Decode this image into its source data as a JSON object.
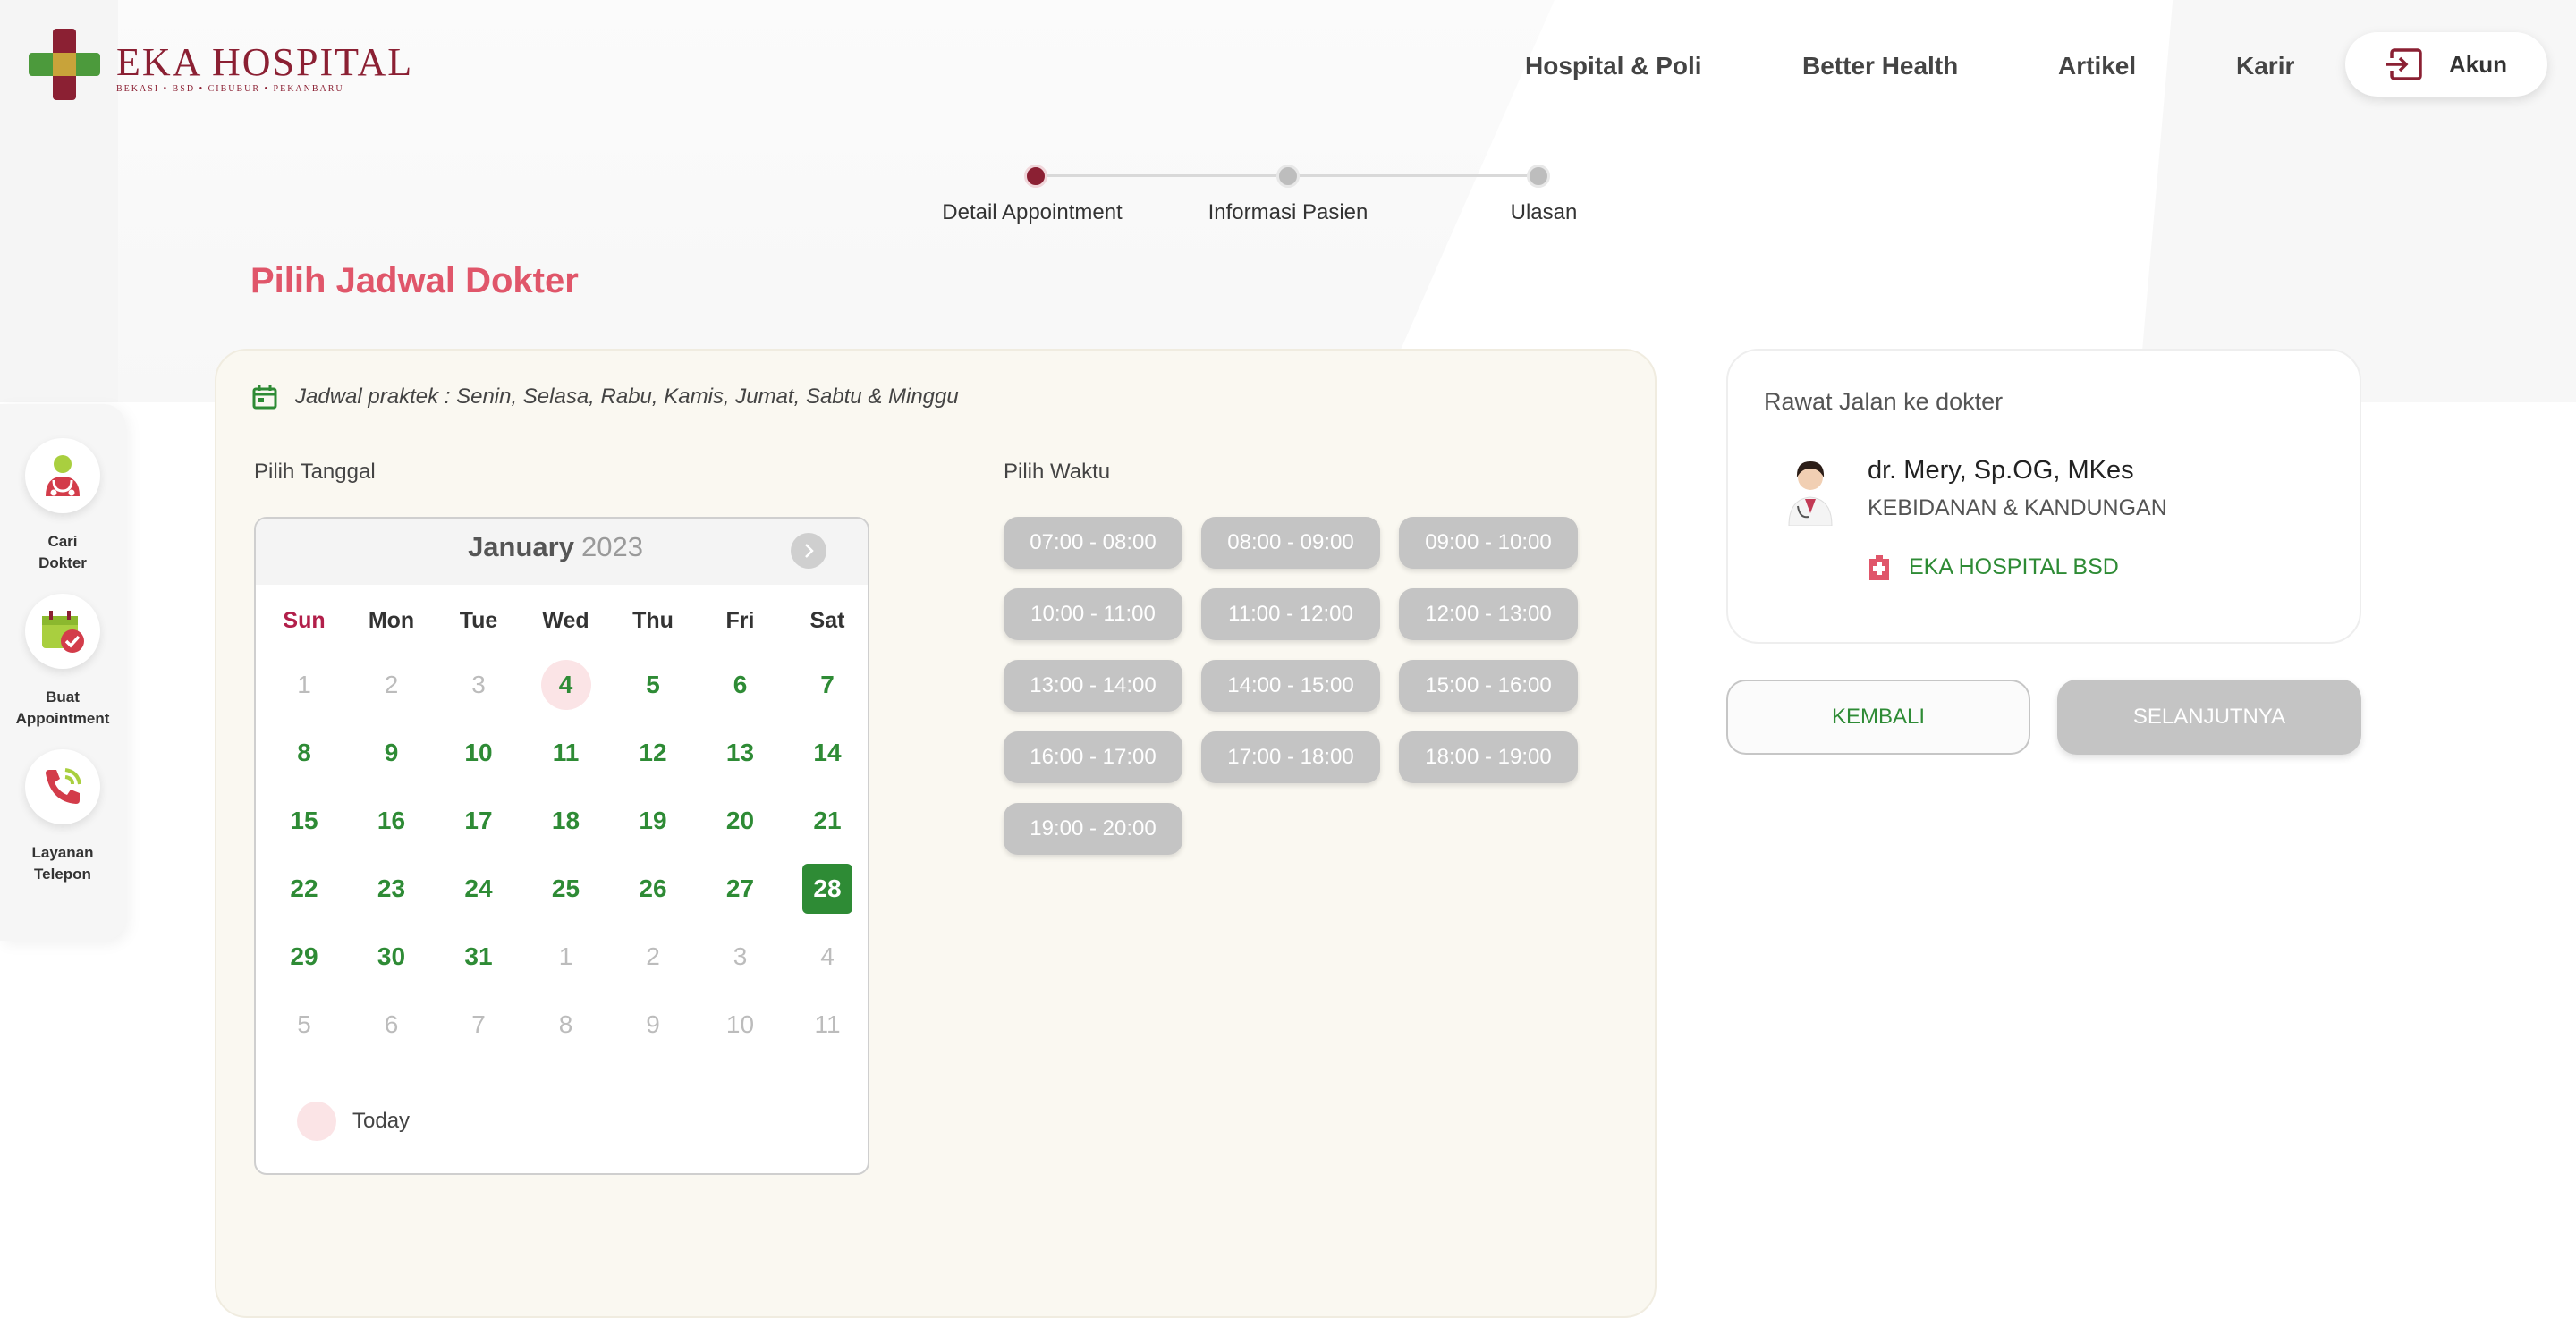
{
  "brand": {
    "title": "EKA HOSPITAL",
    "subtitle": "BEKASI • BSD • CIBUBUR • PEKANBARU"
  },
  "nav": {
    "items": [
      "Hospital & Poli",
      "Better Health",
      "Artikel",
      "Karir"
    ],
    "account_label": "Akun"
  },
  "stepper": {
    "steps": [
      "Detail Appointment",
      "Informasi Pasien",
      "Ulasan"
    ],
    "active_index": 0
  },
  "page_title": "Pilih Jadwal Dokter",
  "sidebar": {
    "items": [
      {
        "label": "Cari Dokter",
        "icon": "doctor-icon"
      },
      {
        "label": "Buat Appointment",
        "icon": "calendar-check-icon"
      },
      {
        "label": "Layanan Telepon",
        "icon": "phone-icon"
      }
    ]
  },
  "schedule": {
    "practice_days": "Jadwal praktek : Senin, Selasa, Rabu, Kamis, Jumat, Sabtu & Minggu",
    "date_label": "Pilih Tanggal",
    "time_label": "Pilih Waktu"
  },
  "calendar": {
    "month": "January",
    "year": "2023",
    "weekdays": [
      "Sun",
      "Mon",
      "Tue",
      "Wed",
      "Thu",
      "Fri",
      "Sat"
    ],
    "weeks": [
      [
        "1",
        "2",
        "3",
        "4",
        "5",
        "6",
        "7"
      ],
      [
        "8",
        "9",
        "10",
        "11",
        "12",
        "13",
        "14"
      ],
      [
        "15",
        "16",
        "17",
        "18",
        "19",
        "20",
        "21"
      ],
      [
        "22",
        "23",
        "24",
        "25",
        "26",
        "27",
        "28"
      ],
      [
        "29",
        "30",
        "31",
        "1",
        "2",
        "3",
        "4"
      ],
      [
        "5",
        "6",
        "7",
        "8",
        "9",
        "10",
        "11"
      ]
    ],
    "muted_cells": [
      "0-0",
      "0-1",
      "0-2",
      "4-3",
      "4-4",
      "4-5",
      "4-6",
      "5-0",
      "5-1",
      "5-2",
      "5-3",
      "5-4",
      "5-5",
      "5-6"
    ],
    "today_cell": "0-3",
    "selected_cell": "3-6",
    "legend_today": "Today"
  },
  "time_slots": [
    "07:00 - 08:00",
    "08:00 - 09:00",
    "09:00 - 10:00",
    "10:00 - 11:00",
    "11:00 - 12:00",
    "12:00 - 13:00",
    "13:00 - 14:00",
    "14:00 - 15:00",
    "15:00 - 16:00",
    "16:00 - 17:00",
    "17:00 - 18:00",
    "18:00 - 19:00",
    "19:00 - 20:00"
  ],
  "doctor": {
    "header": "Rawat Jalan ke dokter",
    "name": "dr. Mery, Sp.OG, MKes",
    "specialty": "KEBIDANAN & KANDUNGAN",
    "hospital": "EKA HOSPITAL BSD"
  },
  "actions": {
    "back_label": "KEMBALI",
    "next_label": "SELANJUTNYA"
  },
  "colors": {
    "brand_red": "#8b2033",
    "accent_pink": "#e0566a",
    "green": "#2e8b35",
    "disabled_gray": "#c4c4c4"
  }
}
